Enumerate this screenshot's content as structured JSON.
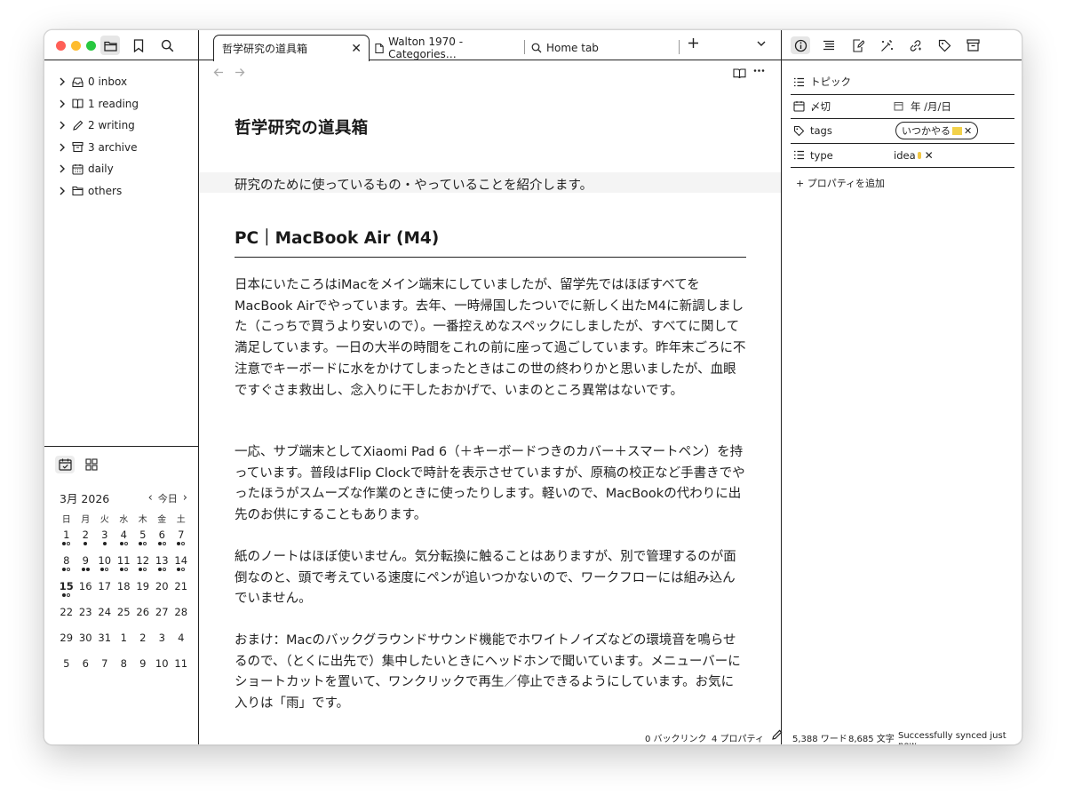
{
  "sidebar": {
    "tree": [
      {
        "label": "0 inbox",
        "icon": "inbox-icon"
      },
      {
        "label": "1 reading",
        "icon": "book-icon"
      },
      {
        "label": "2 writing",
        "icon": "pencil-icon"
      },
      {
        "label": "3 archive",
        "icon": "archive-icon"
      },
      {
        "label": "daily",
        "icon": "calendar-icon"
      },
      {
        "label": "others",
        "icon": "folder-icon"
      }
    ]
  },
  "calendar": {
    "month": "3月 2026",
    "today_label": "今日",
    "weekdays": [
      "日",
      "月",
      "火",
      "水",
      "木",
      "金",
      "土"
    ],
    "weeks": [
      [
        "1",
        "2",
        "3",
        "4",
        "5",
        "6",
        "7"
      ],
      [
        "8",
        "9",
        "10",
        "11",
        "12",
        "13",
        "14"
      ],
      [
        "15",
        "16",
        "17",
        "18",
        "19",
        "20",
        "21"
      ],
      [
        "22",
        "23",
        "24",
        "25",
        "26",
        "27",
        "28"
      ],
      [
        "29",
        "30",
        "31",
        "1",
        "2",
        "3",
        "4"
      ],
      [
        "5",
        "6",
        "7",
        "8",
        "9",
        "10",
        "11"
      ]
    ]
  },
  "tabs": [
    {
      "label": "哲学研究の道具箱",
      "close": "✕"
    },
    {
      "label": "Walton 1970 - Categories…"
    },
    {
      "label": "Home tab"
    }
  ],
  "document": {
    "title": "哲学研究の道具箱",
    "intro": "研究のために使っているもの・やっていることを紹介します。",
    "heading": "PC｜MacBook Air (M4)",
    "paragraphs": [
      "日本にいたころはiMacをメイン端末にしていましたが、留学先ではほぼすべてをMacBook Airでやっています。去年、一時帰国したついでに新しく出たM4に新調しました（こっちで買うより安いので）。一番控えめなスペックにしましたが、すべてに関して満足しています。一日の大半の時間をこれの前に座って過ごしています。昨年末ごろに不注意でキーボードに水をかけてしまったときはこの世の終わりかと思いましたが、血眼ですぐさま救出し、念入りに干したおかげで、いまのところ異常はないです。",
      "一応、サブ端末としてXiaomi Pad 6（＋キーボードつきのカバー＋スマートペン）を持っています。普段はFlip Clockで時計を表示させていますが、原稿の校正など手書きでやったほうがスムーズな作業のときに使ったりします。軽いので、MacBookの代わりに出先のお供にすることもあります。",
      "紙のノートはほぼ使いません。気分転換に触ることはありますが、別で管理するのが面倒なのと、頭で考えている速度にペンが追いつかないので、ワークフローには組み込んでいません。",
      "おまけ：Macのバックグラウンドサウンド機能でホワイトノイズなどの環境音を鳴らせるので、（とくに出先で）集中したいときにヘッドホンで聞いています。メニューバーにショートカットを置いて、ワンクリックで再生／停止できるようにしています。お気に入りは「雨」です。"
    ]
  },
  "status": {
    "backlinks": "0 バックリンク",
    "properties": "4 プロパティ",
    "words": "5,388 ワード",
    "chars": "8,685 文字",
    "sync": "Successfully synced just now"
  },
  "properties": {
    "topic": {
      "name": "トピック"
    },
    "deadline": {
      "name": "〆切",
      "value": "年 /月/日"
    },
    "tags": {
      "name": "tags",
      "value": "いつかやる"
    },
    "type": {
      "name": "type",
      "value": "idea"
    },
    "add_label": "+ プロパティを追加"
  },
  "colors": {
    "red": "#ff5f57",
    "yellow": "#febc2e",
    "green": "#28c840",
    "tag_swatch": "#f2d14a"
  }
}
